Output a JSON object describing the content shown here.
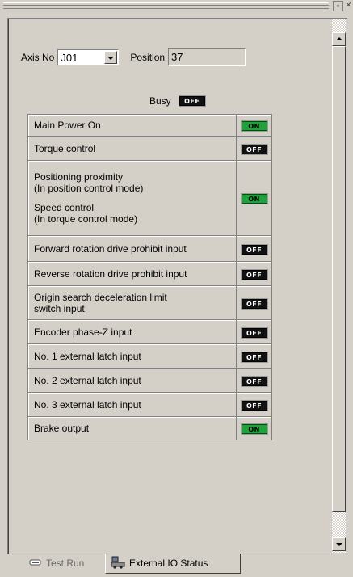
{
  "axis": {
    "label": "Axis No",
    "value": "J01",
    "position_label": "Position",
    "position_value": "37"
  },
  "busy": {
    "label": "Busy",
    "state": "OFF"
  },
  "io_rows": [
    {
      "lines": [
        "Main Power On"
      ],
      "state": "ON"
    },
    {
      "lines": [
        "Torque control"
      ],
      "state": "OFF"
    },
    {
      "lines": [
        "Positioning proximity",
        "(In position control mode)",
        "Speed control",
        "(In torque control mode)"
      ],
      "state": "ON"
    },
    {
      "lines": [
        "Forward rotation drive prohibit input"
      ],
      "state": "OFF"
    },
    {
      "lines": [
        "Reverse rotation drive prohibit input"
      ],
      "state": "OFF"
    },
    {
      "lines": [
        "Origin search deceleration limit",
        "switch input"
      ],
      "state": "OFF"
    },
    {
      "lines": [
        "Encoder phase-Z input"
      ],
      "state": "OFF"
    },
    {
      "lines": [
        "No. 1 external latch input"
      ],
      "state": "OFF"
    },
    {
      "lines": [
        "No. 2 external latch input"
      ],
      "state": "OFF"
    },
    {
      "lines": [
        "No. 3 external latch input"
      ],
      "state": "OFF"
    },
    {
      "lines": [
        "Brake output"
      ],
      "state": "ON"
    }
  ],
  "tabs": [
    {
      "label": "Test Run",
      "icon": "test-run-icon",
      "active": false
    },
    {
      "label": "External IO Status",
      "icon": "io-status-icon",
      "active": true
    }
  ],
  "colors": {
    "on": "#1fa23b",
    "off": "#111111",
    "face": "#d4d0c8"
  }
}
